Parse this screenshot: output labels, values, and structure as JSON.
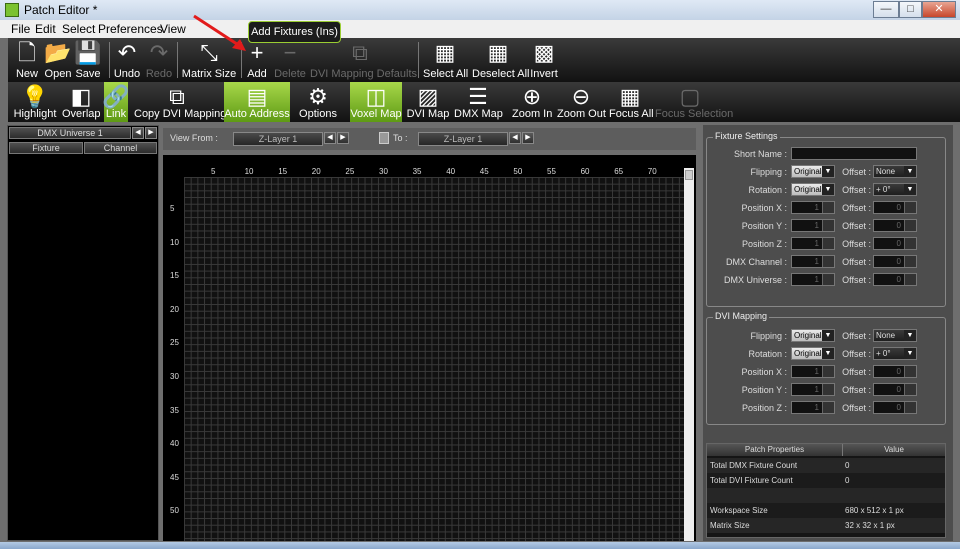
{
  "window": {
    "title": "Patch Editor *",
    "minimize": "—",
    "maximize": "□",
    "close": "✕"
  },
  "menu": [
    "File",
    "Edit",
    "Select",
    "Preferences",
    "View"
  ],
  "toolbar1": [
    {
      "label": "New",
      "icon": "new-document-icon"
    },
    {
      "label": "Open",
      "icon": "folder-open-icon"
    },
    {
      "label": "Save",
      "icon": "floppy-disk-icon"
    },
    {
      "label": "Undo",
      "icon": "undo-arrow-icon"
    },
    {
      "label": "Redo",
      "icon": "redo-arrow-icon",
      "disabled": true
    },
    {
      "label": "Matrix Size",
      "icon": "matrix-size-icon"
    },
    {
      "label": "Add",
      "icon": "plus-icon"
    },
    {
      "label": "Delete",
      "icon": "minus-icon",
      "disabled": true
    },
    {
      "label": "DVI Mapping Defaults",
      "icon": "dvi-defaults-icon",
      "disabled": true
    },
    {
      "label": "Select All",
      "icon": "select-all-icon"
    },
    {
      "label": "Deselect All",
      "icon": "deselect-all-icon"
    },
    {
      "label": "Invert",
      "icon": "invert-selection-icon"
    }
  ],
  "toolbar2": [
    {
      "label": "Highlight",
      "icon": "bulb-icon"
    },
    {
      "label": "Overlap",
      "icon": "overlap-icon"
    },
    {
      "label": "Link",
      "icon": "link-icon",
      "active": true
    },
    {
      "label": "Copy DVI Mapping",
      "icon": "copy-dvi-icon"
    },
    {
      "label": "Auto Address",
      "icon": "auto-address-icon",
      "active": true
    },
    {
      "label": "Options",
      "icon": "gear-icon"
    },
    {
      "label": "Voxel Map",
      "icon": "voxel-map-icon",
      "active": true
    },
    {
      "label": "DVI Map",
      "icon": "dvi-map-icon"
    },
    {
      "label": "DMX Map",
      "icon": "dmx-map-icon"
    },
    {
      "label": "Zoom In",
      "icon": "zoom-in-icon"
    },
    {
      "label": "Zoom Out",
      "icon": "zoom-out-icon"
    },
    {
      "label": "Focus All",
      "icon": "focus-all-icon"
    },
    {
      "label": "Focus Selection",
      "icon": "focus-selection-icon",
      "disabled": true
    }
  ],
  "tooltip": "Add Fixtures (Ins)",
  "left_panel": {
    "universe": "DMX Universe 1",
    "col_fixture": "Fixture",
    "col_channel": "Channel"
  },
  "view": {
    "view_from_label": "View From :",
    "view_from": "Z-Layer 1",
    "to_label": "To :",
    "to": "Z-Layer 1"
  },
  "x_ticks": [
    "5",
    "10",
    "15",
    "20",
    "25",
    "30",
    "35",
    "40",
    "45",
    "50",
    "55",
    "60",
    "65",
    "70"
  ],
  "y_ticks": [
    "5",
    "10",
    "15",
    "20",
    "25",
    "30",
    "35",
    "40",
    "45",
    "50"
  ],
  "fixture_settings": {
    "title": "Fixture Settings",
    "short_name_label": "Short Name :",
    "flipping_label": "Flipping :",
    "flipping": "Original",
    "rotation_label": "Rotation :",
    "rotation": "Original",
    "offset_label": "Offset :",
    "offset_flip": "None",
    "offset_rot": "+ 0°",
    "pos_x_label": "Position X :",
    "pos_y_label": "Position Y :",
    "pos_z_label": "Position Z :",
    "dmx_channel_label": "DMX Channel :",
    "dmx_universe_label": "DMX Universe :",
    "one": "1",
    "zero": "0"
  },
  "dvi_mapping": {
    "title": "DVI Mapping",
    "flipping_label": "Flipping :",
    "flipping": "Original",
    "rotation_label": "Rotation :",
    "rotation": "Original",
    "offset_label": "Offset :",
    "offset_flip": "None",
    "offset_rot": "+ 0°",
    "pos_x_label": "Position X :",
    "pos_y_label": "Position Y :",
    "pos_z_label": "Position Z :",
    "one": "1",
    "zero": "0"
  },
  "patch_properties": {
    "header_name": "Patch Properties",
    "header_value": "Value",
    "rows": [
      {
        "name": "Total DMX Fixture Count",
        "value": "0"
      },
      {
        "name": "Total DVI Fixture Count",
        "value": "0"
      },
      {
        "name": "",
        "value": ""
      },
      {
        "name": "Workspace Size",
        "value": "680 x 512 x 1 px"
      },
      {
        "name": "Matrix Size",
        "value": "32 x 32 x 1 px"
      }
    ]
  }
}
